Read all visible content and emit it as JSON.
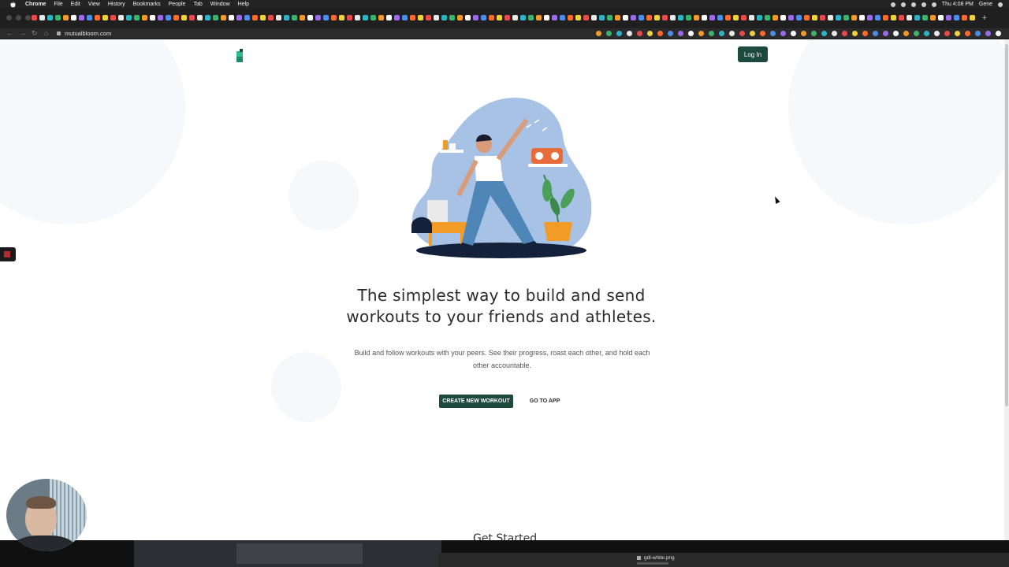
{
  "menubar": {
    "app": "Chrome",
    "items": [
      "File",
      "Edit",
      "View",
      "History",
      "Bookmarks",
      "People",
      "Tab",
      "Window",
      "Help"
    ],
    "clock": "Thu 4:08 PM",
    "user": "Gene"
  },
  "browser": {
    "url": "mutualbloom.com"
  },
  "header": {
    "login_label": "Log In"
  },
  "hero": {
    "headline_line1": "The simplest way to build and send",
    "headline_line2": "workouts to your friends and athletes.",
    "subtitle": "Build and follow workouts with your peers. See their progress, roast each other, and hold each other accountable.",
    "cta_primary": "CREATE NEW WORKOUT",
    "cta_secondary": "GO TO APP"
  },
  "next_section": {
    "partial_title": "Get Started"
  },
  "dock": {
    "file_name": "gdl-white.png"
  },
  "colors": {
    "brand_green": "#1c4a3c",
    "illustration_blue": "#a8c2e6",
    "accent_orange": "#f29b26",
    "background_circle": "#f7f8fc"
  }
}
